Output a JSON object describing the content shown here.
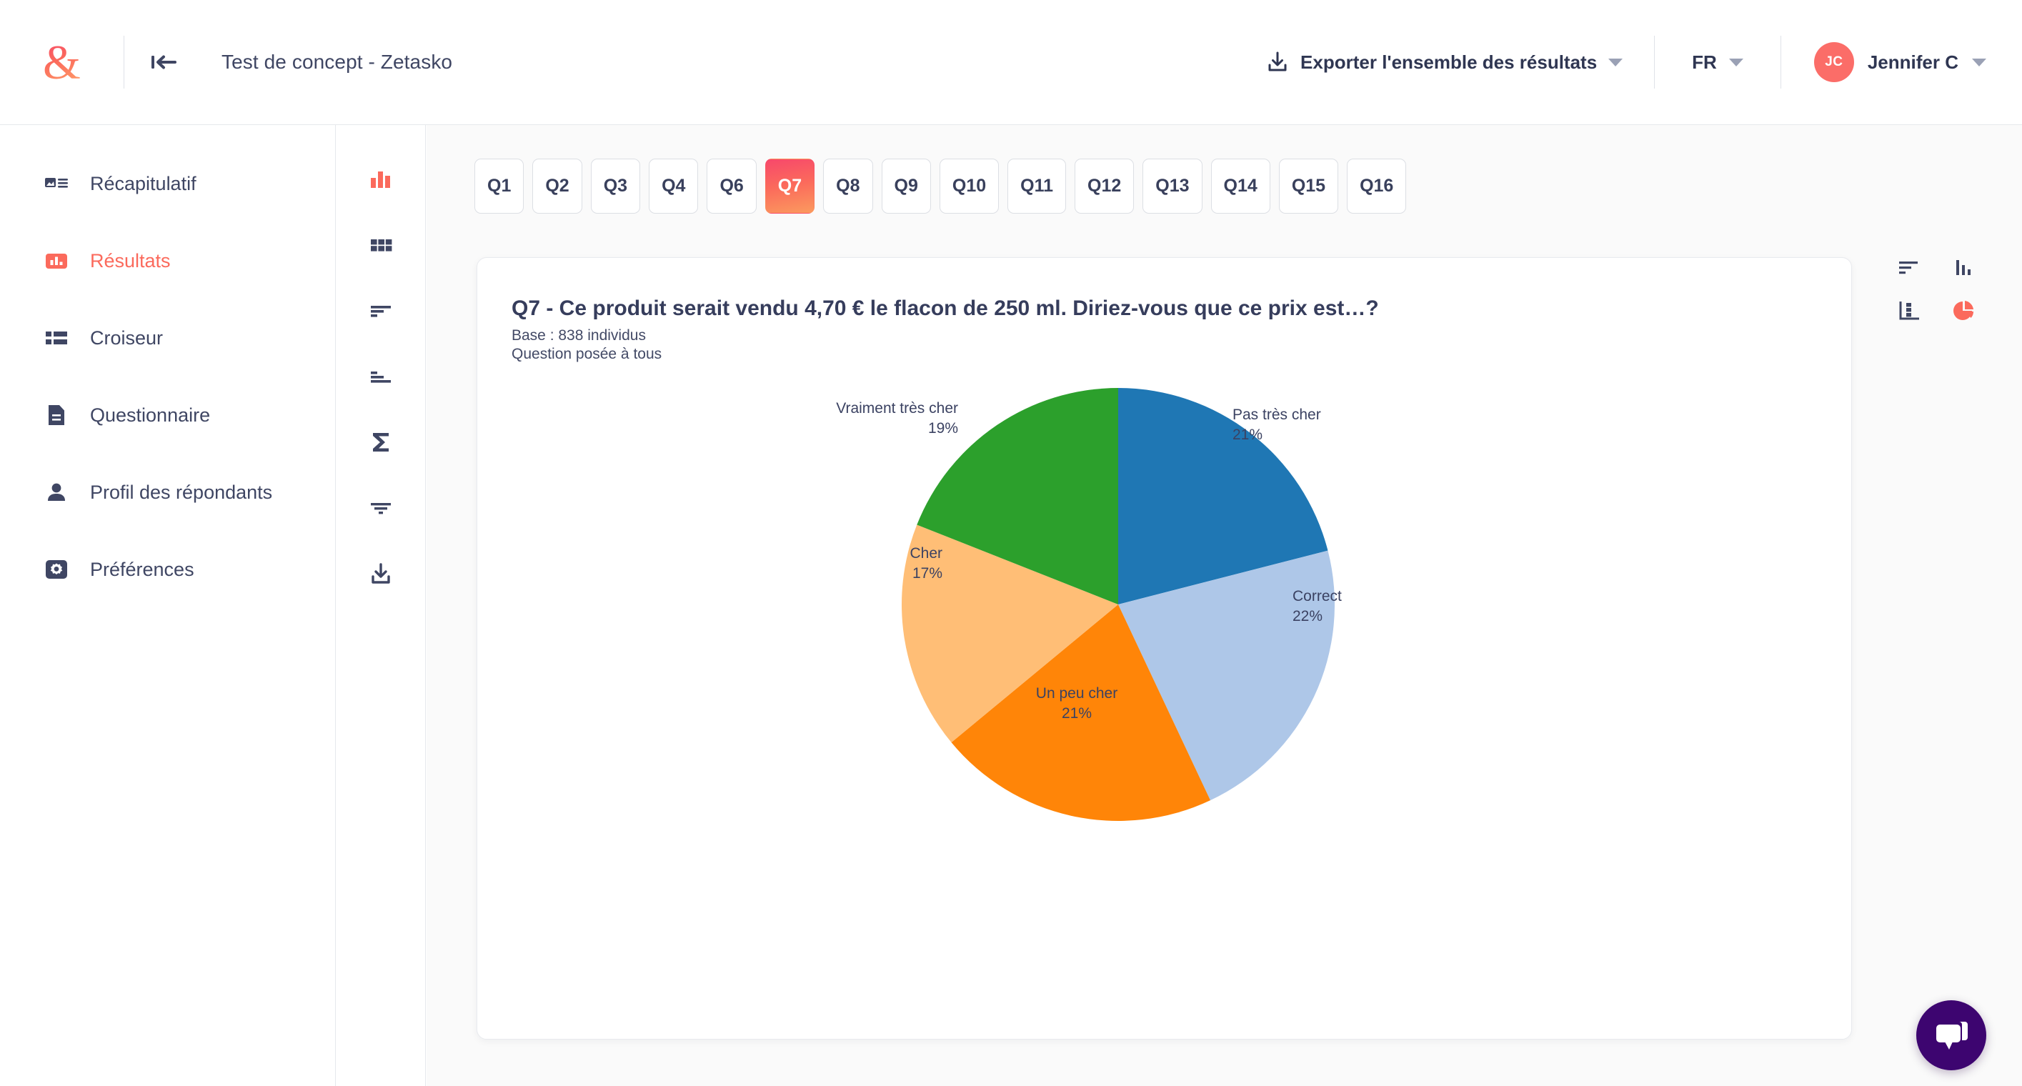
{
  "header": {
    "logo_icon": "ampersand-logo",
    "collapse_icon": "collapse-sidebar-icon",
    "project_title": "Test de concept - Zetasko",
    "export": {
      "icon": "download-icon",
      "label": "Exporter l'ensemble des résultats"
    },
    "language": {
      "label": "FR"
    },
    "user": {
      "initials": "JC",
      "name": "Jennifer C"
    }
  },
  "sidebar": {
    "items": [
      {
        "label": "Récapitulatif",
        "icon": "summary-icon",
        "active": false
      },
      {
        "label": "Résultats",
        "icon": "bar-chart-icon",
        "active": true
      },
      {
        "label": "Croiseur",
        "icon": "crosstab-icon",
        "active": false
      },
      {
        "label": "Questionnaire",
        "icon": "document-icon",
        "active": false
      },
      {
        "label": "Profil des répondants",
        "icon": "person-icon",
        "active": false
      },
      {
        "label": "Préférences",
        "icon": "gear-icon",
        "active": false
      }
    ]
  },
  "icon_rail": {
    "items": [
      {
        "icon": "bar-chart-icon",
        "active": true
      },
      {
        "icon": "grid-icon",
        "active": false
      },
      {
        "icon": "sort-descending-icon",
        "active": false
      },
      {
        "icon": "sort-ascending-icon",
        "active": false
      },
      {
        "icon": "sigma-icon",
        "active": false
      },
      {
        "icon": "filter-icon",
        "active": false
      },
      {
        "icon": "download-icon",
        "active": false
      }
    ]
  },
  "tabs": {
    "items": [
      {
        "label": "Q1",
        "active": false
      },
      {
        "label": "Q2",
        "active": false
      },
      {
        "label": "Q3",
        "active": false
      },
      {
        "label": "Q4",
        "active": false
      },
      {
        "label": "Q6",
        "active": false
      },
      {
        "label": "Q7",
        "active": true
      },
      {
        "label": "Q8",
        "active": false
      },
      {
        "label": "Q9",
        "active": false
      },
      {
        "label": "Q10",
        "active": false
      },
      {
        "label": "Q11",
        "active": false
      },
      {
        "label": "Q12",
        "active": false
      },
      {
        "label": "Q13",
        "active": false
      },
      {
        "label": "Q14",
        "active": false
      },
      {
        "label": "Q15",
        "active": false
      },
      {
        "label": "Q16",
        "active": false
      }
    ]
  },
  "card": {
    "question_title": "Q7 - Ce produit serait vendu 4,70 € le flacon de 250 ml. Diriez-vous que ce prix est…?",
    "base_line": "Base : 838 individus",
    "scope_line": "Question posée à tous"
  },
  "chart_toggles": {
    "items": [
      {
        "icon": "horizontal-bar-chart-icon",
        "active": false
      },
      {
        "icon": "vertical-bar-chart-icon",
        "active": false
      },
      {
        "icon": "column-chart-axis-icon",
        "active": false
      },
      {
        "icon": "pie-chart-icon",
        "active": true
      }
    ],
    "active_color": "#fb6a5c"
  },
  "chat_widget": {
    "icon": "chat-bubbles-icon",
    "color": "#3d0570"
  },
  "chart_data": {
    "type": "pie",
    "title": "Q7 - Ce produit serait vendu 4,70 € le flacon de 250 ml. Diriez-vous que ce prix est…?",
    "base": 838,
    "unit": "%",
    "legend_position": "labels-outside",
    "start_angle_deg": 0,
    "direction": "clockwise",
    "categories": [
      "Pas très cher",
      "Correct",
      "Un peu cher",
      "Cher",
      "Vraiment très cher"
    ],
    "values": [
      21,
      22,
      21,
      17,
      19
    ],
    "labels": [
      "21%",
      "22%",
      "21%",
      "17%",
      "19%"
    ],
    "colors": [
      "#1f77b4",
      "#aec7e8",
      "#ff8508",
      "#ffbe76",
      "#2ca02c"
    ],
    "slices": [
      {
        "name": "Pas très cher",
        "value": 21,
        "label": "21%",
        "color": "#1f77b4"
      },
      {
        "name": "Correct",
        "value": 22,
        "label": "22%",
        "color": "#aec7e8"
      },
      {
        "name": "Un peu cher",
        "value": 21,
        "label": "21%",
        "color": "#ff8508"
      },
      {
        "name": "Cher",
        "value": 17,
        "label": "17%",
        "color": "#ffbe76"
      },
      {
        "name": "Vraiment très cher",
        "value": 19,
        "label": "19%",
        "color": "#2ca02c"
      }
    ]
  }
}
